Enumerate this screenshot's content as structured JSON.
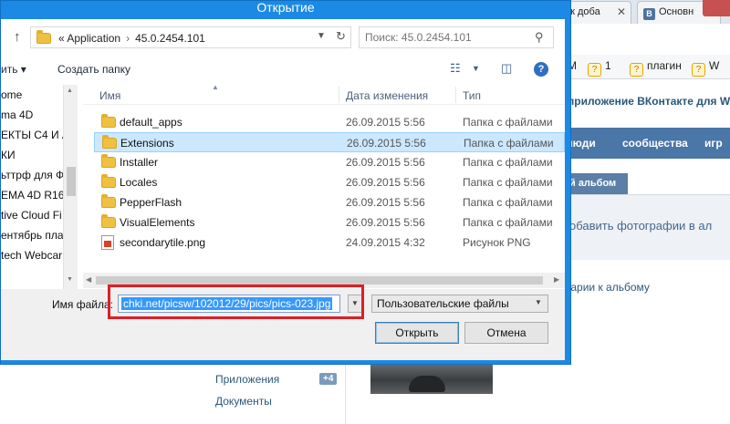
{
  "browser": {
    "tabs": [
      {
        "label": "ак доба"
      },
      {
        "label": "Основн"
      }
    ],
    "bookmarks": [
      {
        "label": "M"
      },
      {
        "label": "1"
      },
      {
        "label": "плагин"
      },
      {
        "label": "W"
      }
    ]
  },
  "vk": {
    "header_text": "приложение ВКонтакте для W",
    "nav": [
      "люди",
      "сообщества",
      "игр"
    ],
    "album_tab": "й альбом",
    "add_photos_text": "обавить фотографии в ал",
    "comments_link": "тарии к альбому",
    "sidebar": [
      {
        "label": "Приложения",
        "count": "+4"
      },
      {
        "label": "Документы"
      }
    ]
  },
  "dialog": {
    "title": "Открытие",
    "address": {
      "crumbs_prefix": "«",
      "crumb1": "Application",
      "crumb2": "45.0.2454.101"
    },
    "search": {
      "placeholder": "Поиск: 45.0.2454.101"
    },
    "toolbar": {
      "organize": "ить ▾",
      "new_folder": "Создать папку"
    },
    "nav_items": [
      "ome",
      "ma 4D",
      "ЕКТЫ C4 И А",
      "КИ",
      "ьттрф для Ф",
      "EMA 4D R16",
      "tive Cloud Fi",
      "ентябрь пла",
      "tech Webcar"
    ],
    "columns": {
      "name": "Имя",
      "date": "Дата изменения",
      "type": "Тип"
    },
    "files": [
      {
        "name": "default_apps",
        "date": "26.09.2015 5:56",
        "type": "Папка с файлами",
        "icon": "folder-icon",
        "selected": false
      },
      {
        "name": "Extensions",
        "date": "26.09.2015 5:56",
        "type": "Папка с файлами",
        "icon": "folder-icon",
        "selected": true
      },
      {
        "name": "Installer",
        "date": "26.09.2015 5:56",
        "type": "Папка с файлами",
        "icon": "folder-icon",
        "selected": false
      },
      {
        "name": "Locales",
        "date": "26.09.2015 5:56",
        "type": "Папка с файлами",
        "icon": "folder-icon",
        "selected": false
      },
      {
        "name": "PepperFlash",
        "date": "26.09.2015 5:56",
        "type": "Папка с файлами",
        "icon": "folder-icon",
        "selected": false
      },
      {
        "name": "VisualElements",
        "date": "26.09.2015 5:56",
        "type": "Папка с файлами",
        "icon": "folder-icon",
        "selected": false
      },
      {
        "name": "secondarytile.png",
        "date": "24.09.2015 4:32",
        "type": "Рисунок PNG",
        "icon": "png-file-icon",
        "selected": false
      }
    ],
    "filename": {
      "label": "Имя файла:",
      "value": "chki.net/picsw/102012/29/pics/pics-023.jpg"
    },
    "filter": {
      "selected": "Пользовательские файлы"
    },
    "buttons": {
      "open": "Открыть",
      "cancel": "Отмена"
    },
    "accent_color": "#1c8ae4",
    "highlight_color": "#e01e25"
  }
}
